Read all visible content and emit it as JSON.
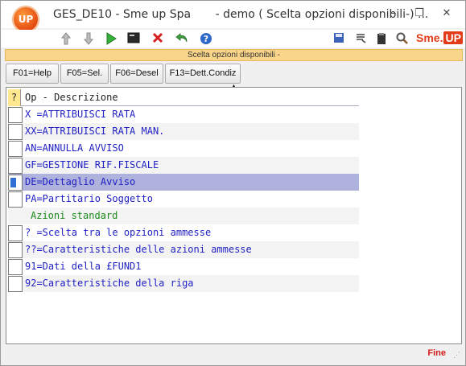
{
  "window": {
    "title": "GES_DE10 - Sme up Spa",
    "subtitle": "- demo ( Scelta opzioni disponibili-) ...",
    "logo_text": "UP",
    "controls": {
      "minimize": "–",
      "restore": "❐",
      "close": "✕"
    }
  },
  "toolbar": {
    "left_icons": [
      "arrow-up-icon",
      "arrow-down-icon",
      "play-icon",
      "console-icon",
      "cancel-icon",
      "undo-icon",
      "help-icon"
    ],
    "right_icons": [
      "save-icon",
      "list-icon",
      "clipboard-icon",
      "search-icon"
    ],
    "brand_text": "Sme.",
    "brand_badge": "UP"
  },
  "header_band": "Scelta opzioni disponibili -",
  "function_keys": [
    "F01=Help",
    "F05=Sel.",
    "F06=Desel",
    "F13=Dett.Condiz"
  ],
  "grid": {
    "header_marker": "?",
    "header_label": "Op - Descrizione",
    "rows": [
      {
        "text": "X =ATTRIBUISCI RATA",
        "type": "option"
      },
      {
        "text": "XX=ATTRIBUISCI RATA MAN.",
        "type": "option"
      },
      {
        "text": "AN=ANNULLA AVVISO",
        "type": "option"
      },
      {
        "text": "GF=GESTIONE RIF.FISCALE",
        "type": "option"
      },
      {
        "text": "DE=Dettaglio Avviso",
        "type": "option",
        "selected": true
      },
      {
        "text": "PA=Partitario Soggetto",
        "type": "option"
      },
      {
        "text": "Azioni standard",
        "type": "section"
      },
      {
        "text": "? =Scelta tra le opzioni ammesse",
        "type": "option"
      },
      {
        "text": "??=Caratteristiche delle azioni ammesse",
        "type": "option"
      },
      {
        "text": "91=Dati della £FUND1",
        "type": "option"
      },
      {
        "text": "92=Caratteristiche della riga",
        "type": "option"
      }
    ]
  },
  "status": {
    "text": "Fine"
  },
  "colors": {
    "option_text": "#1f1fc4",
    "section_text": "#1a8a1a",
    "selected_row": "#aeb2dc",
    "band": "#f9d58a",
    "status_text": "#d21a1a"
  }
}
